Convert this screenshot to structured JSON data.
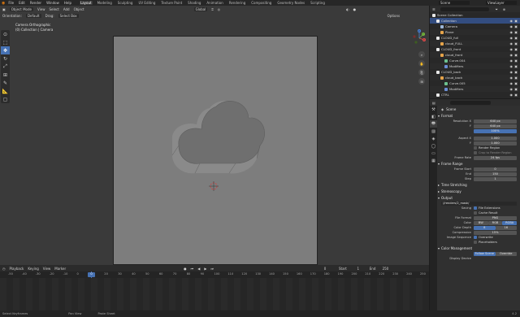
{
  "menu": {
    "items": [
      "File",
      "Edit",
      "Render",
      "Window",
      "Help"
    ],
    "workspaces": [
      "Layout",
      "Modeling",
      "Sculpting",
      "UV Editing",
      "Texture Paint",
      "Shading",
      "Animation",
      "Rendering",
      "Compositing",
      "Geometry Nodes",
      "Scripting"
    ],
    "active_workspace": "Layout",
    "scene": "Scene",
    "view_layer": "ViewLayer"
  },
  "viewport": {
    "mode": "Object Mode",
    "menus": [
      "View",
      "Select",
      "Add",
      "Object"
    ],
    "transform": "Global",
    "orientation_label": "Orientation:",
    "orientation_value": "Default",
    "drag_label": "Drag:",
    "drag_value": "Select Box",
    "options": "Options",
    "camera_title": "Camera Orthographic",
    "camera_subtitle": "(0) Collection | Camera",
    "gizmo_axes": [
      "X",
      "Y",
      "Z"
    ]
  },
  "outliner": {
    "rows": [
      {
        "label": "Scene Collection",
        "indent": 0,
        "icon": "collection-icon"
      },
      {
        "label": "Collection",
        "indent": 1,
        "icon": "collection-icon",
        "selected": true
      },
      {
        "label": "Camera",
        "indent": 2,
        "icon": "camera-icon"
      },
      {
        "label": "Plane",
        "indent": 2,
        "icon": "mesh-icon"
      },
      {
        "label": "CLOUD_full",
        "indent": 1,
        "icon": "collection-icon"
      },
      {
        "label": "cloud_FULL",
        "indent": 2,
        "icon": "mesh-icon"
      },
      {
        "label": "CLOUD_front",
        "indent": 1,
        "icon": "collection-icon"
      },
      {
        "label": "cloud_front",
        "indent": 2,
        "icon": "mesh-icon"
      },
      {
        "label": "Curve.004",
        "indent": 3,
        "icon": "curve-icon"
      },
      {
        "label": "Modifiers",
        "indent": 3,
        "icon": "wrench-icon"
      },
      {
        "label": "CLOUD_back",
        "indent": 1,
        "icon": "collection-icon"
      },
      {
        "label": "cloud_back",
        "indent": 2,
        "icon": "mesh-icon"
      },
      {
        "label": "Curve.005",
        "indent": 3,
        "icon": "curve-icon"
      },
      {
        "label": "Modifiers",
        "indent": 3,
        "icon": "wrench-icon"
      },
      {
        "label": "CTRL",
        "indent": 1,
        "icon": "collection-icon"
      }
    ]
  },
  "properties": {
    "context": "Scene",
    "format": {
      "header": "Format",
      "res_x_label": "Resolution X",
      "res_x": "640 px",
      "res_y_label": "Y",
      "res_y": "640 px",
      "percent": "100%",
      "aspect_x_label": "Aspect X",
      "aspect_x": "1.000",
      "aspect_y_label": "Y",
      "aspect_y": "1.000",
      "render_region": "Render Region",
      "crop": "Crop to Render Region",
      "frame_rate_label": "Frame Rate",
      "frame_rate": "24 fps"
    },
    "frame_range": {
      "header": "Frame Range",
      "start_label": "Frame Start",
      "start": "0",
      "end_label": "End",
      "end": "150",
      "step_label": "Step",
      "step": "1"
    },
    "time_stretching": "Time Stretching",
    "stereoscopy": "Stereoscopy",
    "output": {
      "header": "Output",
      "path": "//renders/2_mask/",
      "saving_label": "Saving",
      "file_ext": "File Extensions",
      "cache_result": "Cache Result",
      "file_format_label": "File Format",
      "file_format": "PNG",
      "color_label": "Color",
      "color_opts": [
        "BW",
        "RGB",
        "RGBA"
      ],
      "color_depth_label": "Color Depth",
      "depth_opts": [
        "8",
        "16"
      ],
      "compression_label": "Compression",
      "compression": "15%",
      "image_seq_label": "Image Sequence",
      "overwrite": "Overwrite",
      "placeholders": "Placeholders"
    },
    "color_management": {
      "header": "Color Management",
      "follow_scene": "Follow Scene",
      "override": "Override",
      "display_label": "Display Device"
    }
  },
  "timeline": {
    "menus": [
      "Playback",
      "Keying",
      "View",
      "Marker"
    ],
    "current_frame": "0",
    "start_label": "Start",
    "start": "1",
    "end_label": "End",
    "end": "250",
    "ruler": [
      "-50",
      "-40",
      "-30",
      "-20",
      "-10",
      "0",
      "10",
      "20",
      "30",
      "40",
      "50",
      "60",
      "70",
      "80",
      "90",
      "100",
      "110",
      "120",
      "130",
      "140",
      "150",
      "160",
      "170",
      "180",
      "190",
      "200",
      "210",
      "220",
      "230",
      "240",
      "250"
    ]
  },
  "statusbar": {
    "left": "Select Keyframes",
    "mid1": "Pan View",
    "mid2": "Paste Sheet",
    "version": "4.2"
  },
  "colors": {
    "accent": "#4772b3",
    "selection": "#334d80",
    "viewport_bg": "#3a3a3a",
    "camera_frame": "#7d7d7d"
  }
}
